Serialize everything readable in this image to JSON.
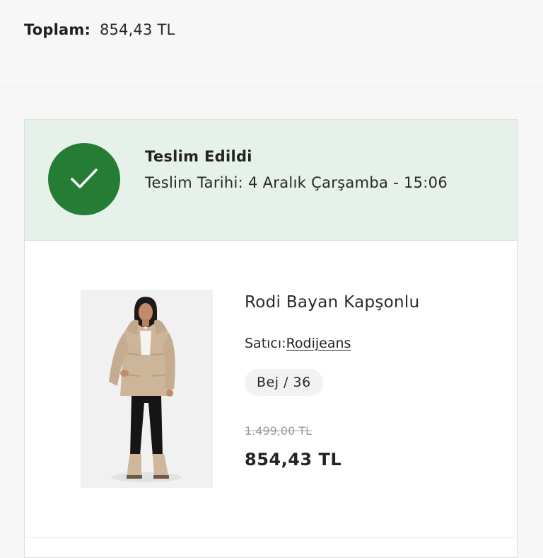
{
  "summary": {
    "total_label": "Toplam:",
    "total_value": "854,43 TL"
  },
  "order": {
    "status": {
      "title": "Teslim Edildi",
      "date_text": "Teslim Tarihi: 4 Aralık Çarşamba - 15:06",
      "icon": "checkmark-icon",
      "color": "#257c35",
      "banner_color": "#e6f1e9"
    },
    "item": {
      "name": "Rodi Bayan Kapşonlu",
      "seller_label": "Satıcı:",
      "seller_name": "Rodijeans",
      "variant": "Bej / 36",
      "old_price": "1.499,00 TL",
      "price": "854,43 TL",
      "image_icon": "product-photo"
    }
  }
}
